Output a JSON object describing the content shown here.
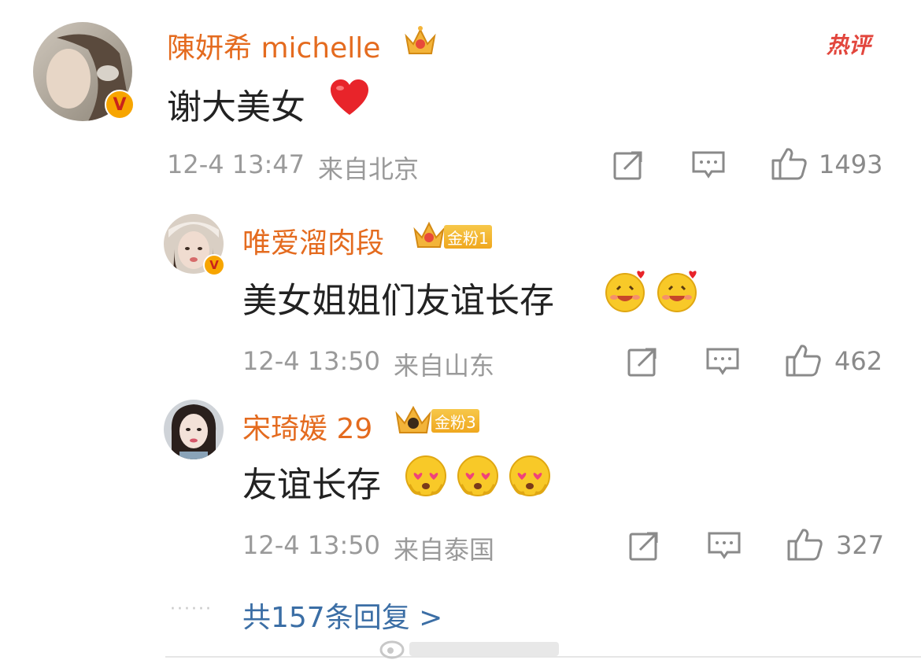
{
  "comments": [
    {
      "username": "陳妍希 michelle",
      "text": "谢大美女",
      "text_emoji": "heart-emoji",
      "date": "12-4 13:47",
      "location": "来自北京",
      "likes": "1493",
      "hot_label": "热评",
      "verified": true
    },
    {
      "username": "唯爱溜肉段",
      "fan_badge": "金粉1",
      "text": "美女姐姐们友谊长存",
      "text_emoji": "blushing-smile-emoji x2",
      "date": "12-4 13:50",
      "location": "来自山东",
      "likes": "462",
      "verified": true
    },
    {
      "username": "宋琦媛 29",
      "fan_badge": "金粉3",
      "text": "友谊长存",
      "text_emoji": "heart-eyes-emoji x3",
      "date": "12-4 13:50",
      "location": "来自泰国",
      "likes": "327"
    }
  ],
  "replies_link": "共157条回复 >",
  "colors": {
    "username": "#e46b1f",
    "link": "#3b6ea5",
    "meta": "#9a9a9a",
    "hot": "#e2463d"
  }
}
